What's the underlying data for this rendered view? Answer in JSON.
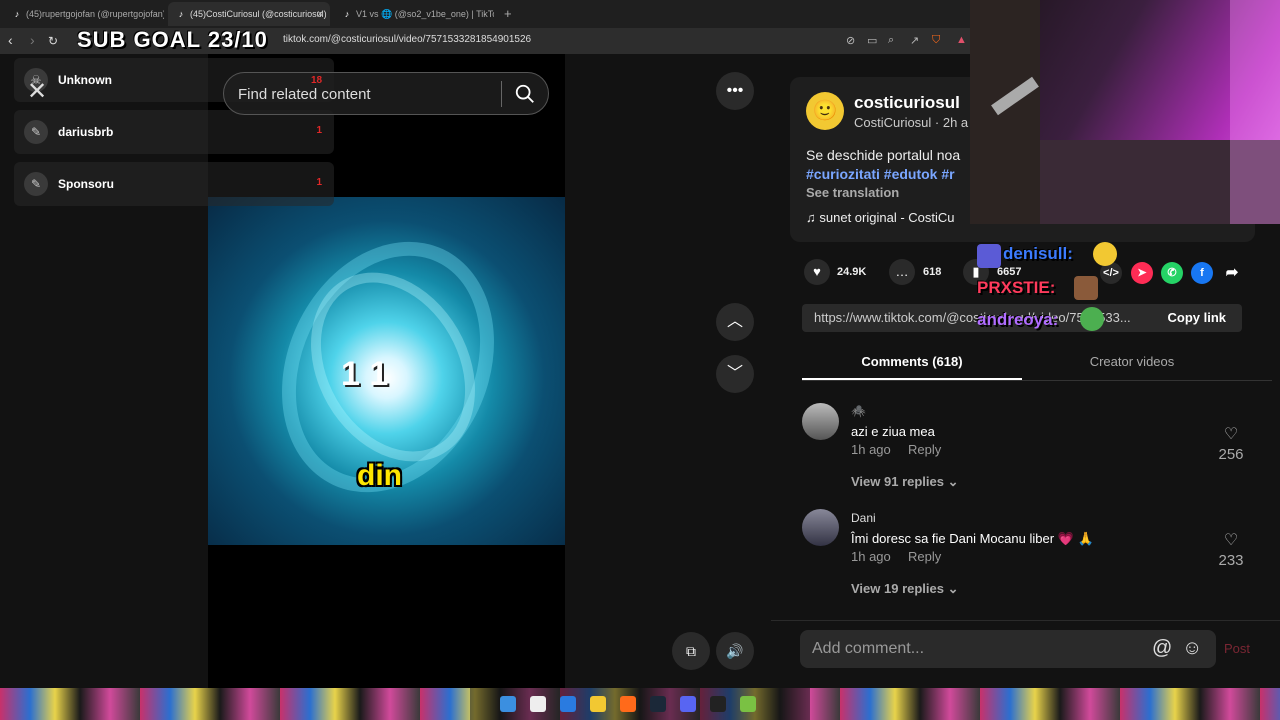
{
  "browser": {
    "tabs": [
      {
        "label": "(45)rupertgojofan (@rupertgojofan)"
      },
      {
        "label": "(45)CostiCuriosul (@costicuriosul)"
      },
      {
        "label": "V1 vs 🌐 (@so2_v1be_one) | TikTok"
      }
    ],
    "new_tab": "+",
    "url": "tiktok.com/@costicuriosul/video/7571533281854901526"
  },
  "overlay": {
    "sub_goal": "SUB GOAL 23/10"
  },
  "sidebar": {
    "items": [
      {
        "label": "Unknown",
        "count": "18"
      },
      {
        "label": "dariusbrb",
        "count": "1"
      },
      {
        "label": "Sponsoru",
        "count": "1"
      }
    ]
  },
  "search": {
    "placeholder": "Find related content"
  },
  "video": {
    "caption_top": "1   1",
    "caption_bottom": "din"
  },
  "post": {
    "username": "costicuriosul",
    "nickname": "CostiCuriosul · 2h a",
    "description": "Se deschide portalul noa",
    "hashtags": "#curiozitati #edutok #r",
    "see_translation": "See translation",
    "music": "sunet original - CostiCu",
    "likes": "24.9K",
    "comments": "618",
    "saves": "6657",
    "link": "https://www.tiktok.com/@costicuriosul/video/7571533...",
    "copy_link": "Copy link"
  },
  "tabs": {
    "comments": "Comments (618)",
    "creator_videos": "Creator videos"
  },
  "comments": [
    {
      "name": "🕷️",
      "text": "azi e ziua mea",
      "time": "1h ago",
      "reply": "Reply",
      "view_replies": "View 91 replies ⌄",
      "likes": "256"
    },
    {
      "name": "Dani",
      "text": "Îmi doresc sa fie Dani Mocanu liber 💗 🙏",
      "time": "1h ago",
      "reply": "Reply",
      "view_replies": "View 19 replies ⌄",
      "likes": "233"
    }
  ],
  "comment_bar": {
    "placeholder": "Add comment...",
    "post": "Post"
  },
  "chat": [
    {
      "name": "denisull:",
      "color": "#3c7bff"
    },
    {
      "name": "PRXSTIE:",
      "color": "#ff3b5c"
    },
    {
      "name": "andreoya:",
      "color": "#b06cff"
    }
  ],
  "colors": {
    "accent_red": "#fe2c55",
    "hashtag_blue": "#7aa6ff"
  }
}
